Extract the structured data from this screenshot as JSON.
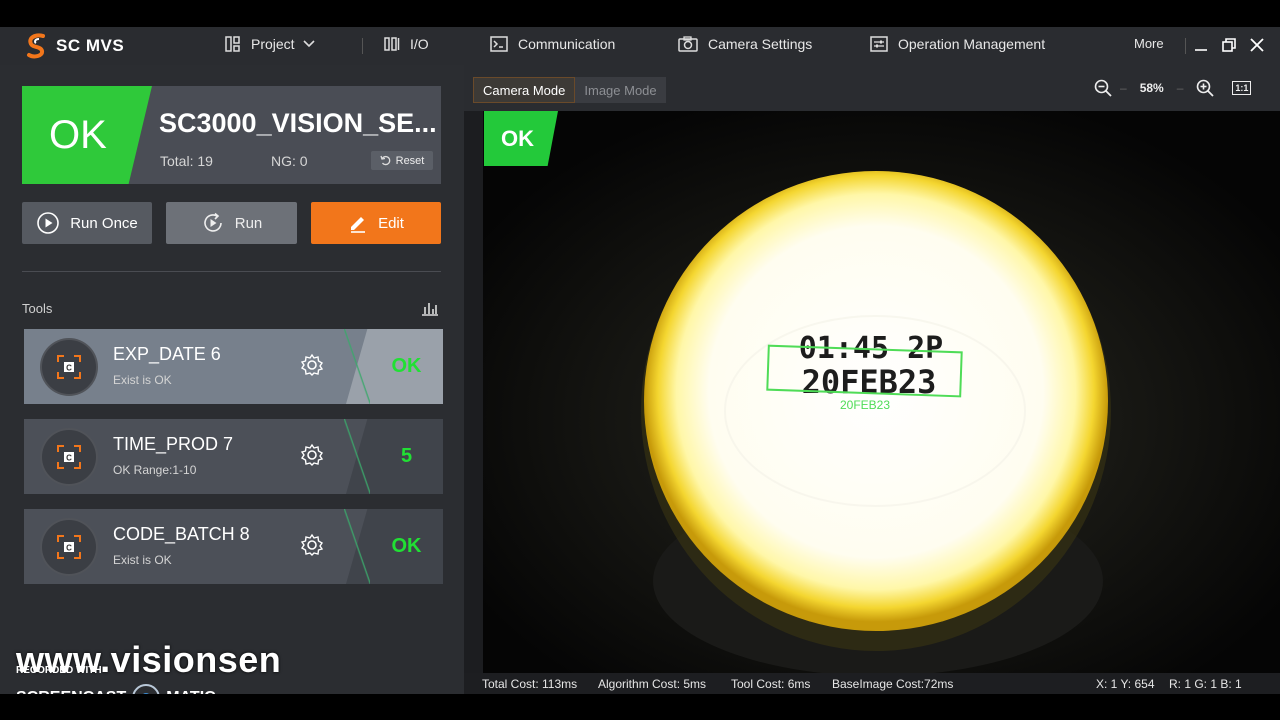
{
  "app": {
    "title": "SC MVS",
    "menu": [
      {
        "label": "Project",
        "icon": "project-icon"
      },
      {
        "label": "I/O",
        "icon": "io-icon"
      },
      {
        "label": "Communication",
        "icon": "terminal-icon"
      },
      {
        "label": "Camera Settings",
        "icon": "camera-icon"
      },
      {
        "label": "Operation Management",
        "icon": "settings-panel-icon"
      }
    ],
    "more_label": "More"
  },
  "status": {
    "result": "OK",
    "solution_name": "SC3000_VISION_SE...",
    "total": "Total: 19",
    "ng": "NG: 0",
    "reset_label": "Reset"
  },
  "actions": {
    "run_once": "Run Once",
    "run": "Run",
    "edit": "Edit"
  },
  "tools": {
    "label": "Tools",
    "items": [
      {
        "name": "EXP_DATE 6",
        "sub": "Exist is OK",
        "result": "OK"
      },
      {
        "name": "TIME_PROD 7",
        "sub": "OK Range:1-10",
        "result": "5"
      },
      {
        "name": "CODE_BATCH 8",
        "sub": "Exist is OK",
        "result": "OK"
      }
    ]
  },
  "watermark": {
    "url": "www.visionsen",
    "recorded": "RECORDED WITH",
    "brand_left": "SCREENCAST",
    "brand_right": "MATIC"
  },
  "view": {
    "tabs": [
      "Camera Mode",
      "Image Mode"
    ],
    "zoom": "58%",
    "fit_label": "1:1",
    "image_result": "OK",
    "print_line1": "01:45 2P",
    "print_line2": "20FEB23",
    "ocr_text": "20FEB23",
    "colors": {
      "ok_green": "#23c93a",
      "edit_orange": "#f2761b",
      "roi_green": "#4fdc57"
    }
  },
  "footer": {
    "total_cost": "Total Cost: 113ms",
    "algo_cost": "Algorithm Cost: 5ms",
    "tool_cost": "Tool Cost: 6ms",
    "base_cost": "BaseImage Cost:72ms",
    "coords": "X: 1 Y: 654",
    "rgb": "R: 1 G: 1 B: 1"
  }
}
